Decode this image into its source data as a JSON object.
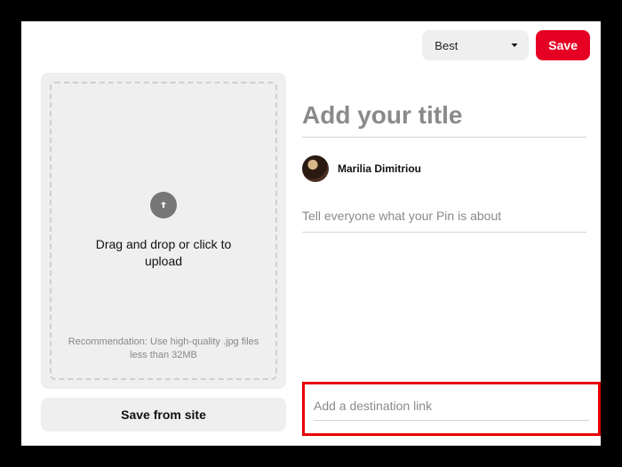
{
  "topbar": {
    "board_selected": "Best",
    "save_label": "Save"
  },
  "upload": {
    "drag_text": "Drag and drop or click to upload",
    "recommendation": "Recommendation: Use high-quality .jpg files less than 32MB",
    "save_from_site_label": "Save from site"
  },
  "form": {
    "title_placeholder": "Add your title",
    "title_value": "",
    "author_name": "Marilia Dimitriou",
    "desc_placeholder": "Tell everyone what your Pin is about",
    "desc_value": "",
    "link_placeholder": "Add a destination link",
    "link_value": ""
  }
}
